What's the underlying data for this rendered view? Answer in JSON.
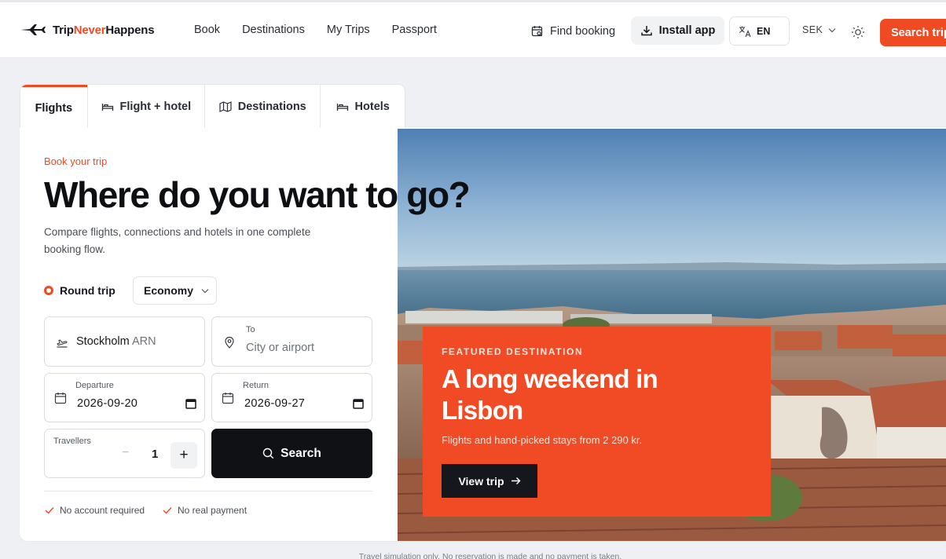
{
  "brand": {
    "name_a": "Trip",
    "name_b": "Never",
    "name_c": "Happens",
    "accent": "#f04a23"
  },
  "nav": {
    "items": [
      "Book",
      "Destinations",
      "My Trips",
      "Passport"
    ]
  },
  "header": {
    "find_booking": "Find booking",
    "install_app": "Install app",
    "language": "EN",
    "currency": "SEK",
    "search_trips": "Search trips"
  },
  "tabs": [
    {
      "label": "Flights",
      "icon": "plane-icon"
    },
    {
      "label": "Flight + hotel",
      "icon": "bed-icon"
    },
    {
      "label": "Destinations",
      "icon": "map-icon"
    },
    {
      "label": "Hotels",
      "icon": "bed-icon"
    }
  ],
  "hero": {
    "eyebrow": "Book your trip",
    "headline": "Where do you want to go?",
    "subtext": "Compare flights, connections and hotels in one complete booking flow."
  },
  "form": {
    "trip_type": "Round trip",
    "cabin": "Economy",
    "from_city": "Stockholm",
    "from_code": "ARN",
    "to_label": "To",
    "to_placeholder": "City or airport",
    "departure_label": "Departure",
    "departure_value": "2026-09-20",
    "return_label": "Return",
    "return_value": "2026-09-27",
    "travellers_label": "Travellers",
    "travellers_value": "1",
    "minus": "−",
    "plus": "+",
    "search": "Search"
  },
  "assurances": [
    "No account required",
    "No real payment"
  ],
  "featured": {
    "eyebrow": "FEATURED DESTINATION",
    "title": "A long weekend in Lisbon",
    "sub": "Flights and hand-picked stays from 2 290 kr.",
    "button": "View trip"
  },
  "footnote": "Travel simulation only. No reservation is made and no payment is taken."
}
